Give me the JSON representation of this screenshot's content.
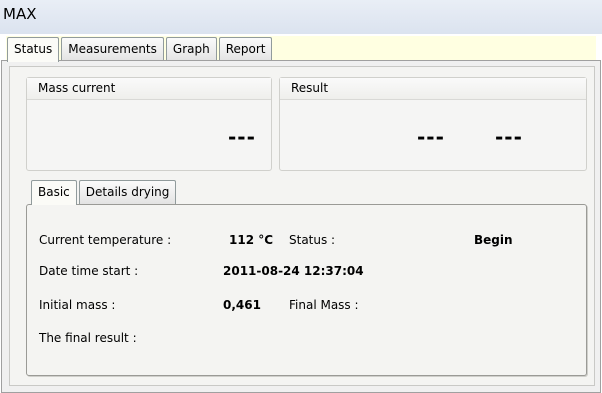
{
  "window": {
    "title": "MAX"
  },
  "tabs": [
    "Status",
    "Measurements",
    "Graph",
    "Report"
  ],
  "mass_current": {
    "label": "Mass current",
    "value": "---"
  },
  "result": {
    "label": "Result",
    "value1": "---",
    "value2": "---"
  },
  "sub_tabs": [
    "Basic",
    "Details drying"
  ],
  "basic": {
    "current_temperature_label": "Current temperature :",
    "current_temperature_value": "112 °C",
    "status_label": "Status :",
    "status_value": "Begin",
    "date_time_start_label": "Date time start :",
    "date_time_start_value": "2011-08-24 12:37:04",
    "initial_mass_label": "Initial mass :",
    "initial_mass_value": "0,461",
    "final_mass_label": "Final Mass :",
    "final_result_label": "The final result :"
  }
}
